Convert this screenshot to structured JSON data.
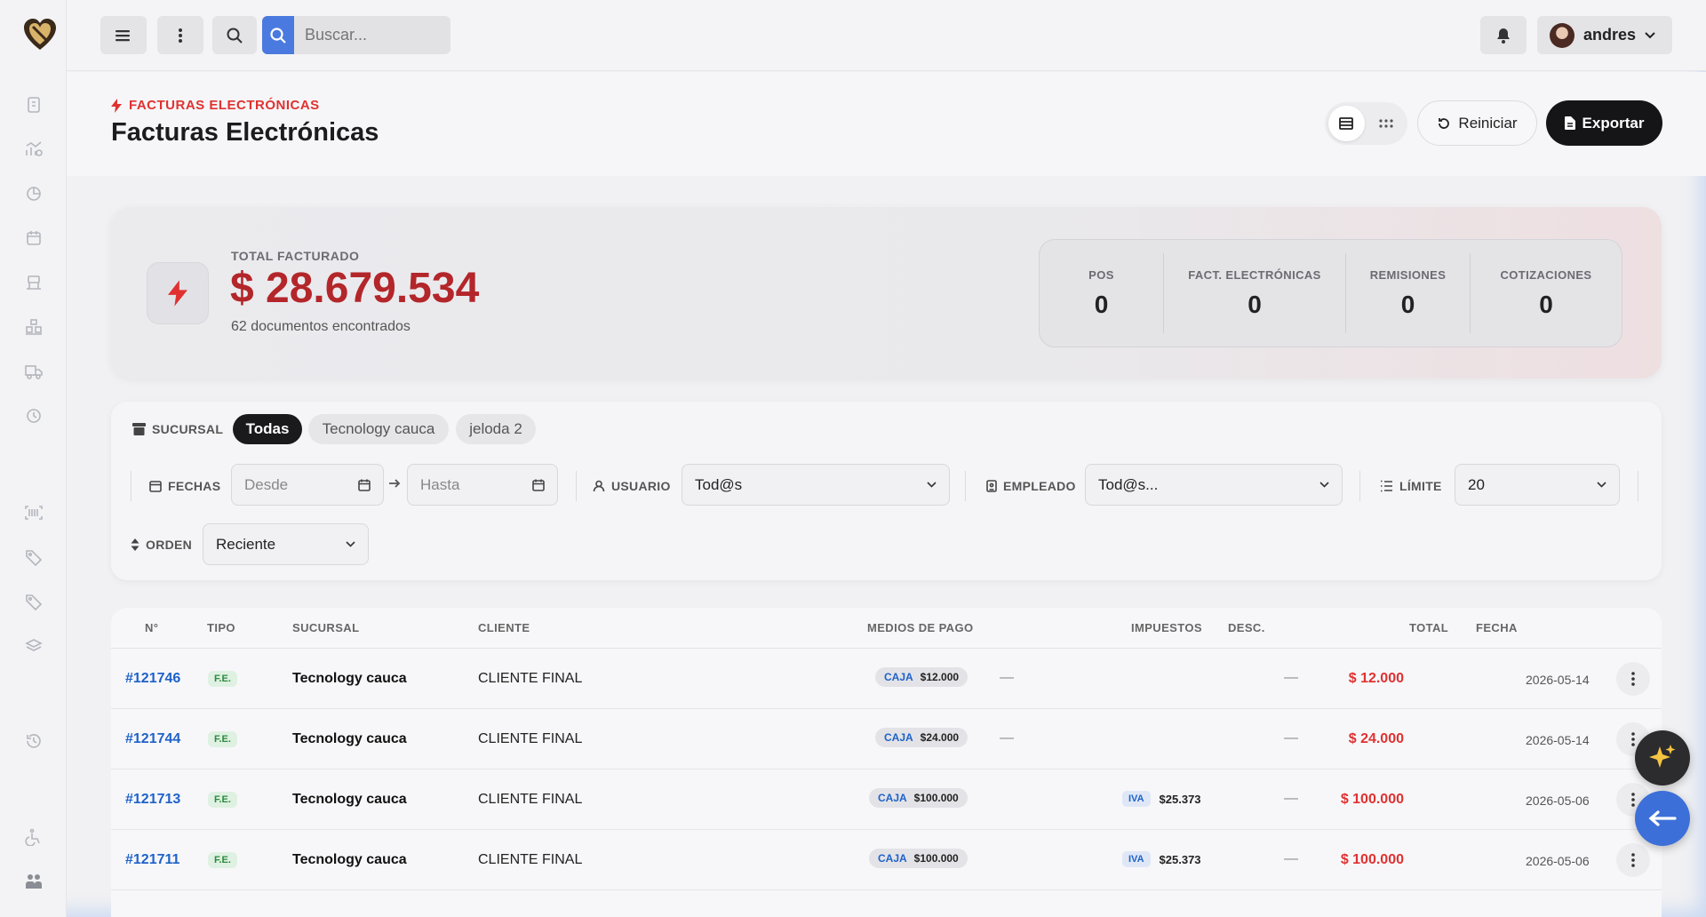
{
  "topbar": {
    "search_placeholder": "Buscar...",
    "user_name": "andres"
  },
  "header": {
    "eyebrow": "FACTURAS ELECTRÓNICAS",
    "title": "Facturas Electrónicas",
    "reset_label": "Reiniciar",
    "export_label": "Exportar"
  },
  "summary": {
    "total_label": "TOTAL FACTURADO",
    "total_value": "$ 28.679.534",
    "docs_found": "62 documentos encontrados",
    "counts": [
      {
        "label": "POS",
        "value": "0"
      },
      {
        "label": "FACT. ELECTRÓNICAS",
        "value": "0"
      },
      {
        "label": "REMISIONES",
        "value": "0"
      },
      {
        "label": "COTIZACIONES",
        "value": "0"
      }
    ]
  },
  "filters": {
    "sucursal_label": "SUCURSAL",
    "branches": [
      "Todas",
      "Tecnology cauca",
      "jeloda 2"
    ],
    "fechas_label": "FECHAS",
    "desde_placeholder": "Desde",
    "hasta_placeholder": "Hasta",
    "usuario_label": "USUARIO",
    "usuario_value": "Tod@s",
    "empleado_label": "EMPLEADO",
    "empleado_value": "Tod@s...",
    "limite_label": "LÍMITE",
    "limite_value": "20",
    "orden_label": "ORDEN",
    "orden_value": "Reciente"
  },
  "table": {
    "columns": [
      "N°",
      "TIPO",
      "SUCURSAL",
      "CLIENTE",
      "MEDIOS DE PAGO",
      "IMPUESTOS",
      "DESC.",
      "TOTAL",
      "FECHA"
    ],
    "rows": [
      {
        "num": "#121746",
        "tipo": "F.E.",
        "sucursal": "Tecnology cauca",
        "cliente": "CLIENTE FINAL",
        "pago_metodo": "CAJA",
        "pago_valor": "$12.000",
        "impuesto_tipo": "",
        "impuesto_valor": "—",
        "desc": "—",
        "total": "$ 12.000",
        "fecha": "2026-05-14"
      },
      {
        "num": "#121744",
        "tipo": "F.E.",
        "sucursal": "Tecnology cauca",
        "cliente": "CLIENTE FINAL",
        "pago_metodo": "CAJA",
        "pago_valor": "$24.000",
        "impuesto_tipo": "",
        "impuesto_valor": "—",
        "desc": "—",
        "total": "$ 24.000",
        "fecha": "2026-05-14"
      },
      {
        "num": "#121713",
        "tipo": "F.E.",
        "sucursal": "Tecnology cauca",
        "cliente": "CLIENTE FINAL",
        "pago_metodo": "CAJA",
        "pago_valor": "$100.000",
        "impuesto_tipo": "IVA",
        "impuesto_valor": "$25.373",
        "desc": "—",
        "total": "$ 100.000",
        "fecha": "2026-05-06"
      },
      {
        "num": "#121711",
        "tipo": "F.E.",
        "sucursal": "Tecnology cauca",
        "cliente": "CLIENTE FINAL",
        "pago_metodo": "CAJA",
        "pago_valor": "$100.000",
        "impuesto_tipo": "IVA",
        "impuesto_valor": "$25.373",
        "desc": "—",
        "total": "$ 100.000",
        "fecha": "2026-05-06"
      }
    ]
  },
  "colors": {
    "accent_red": "#e03131",
    "link_blue": "#1f62c9",
    "dark": "#151517"
  }
}
